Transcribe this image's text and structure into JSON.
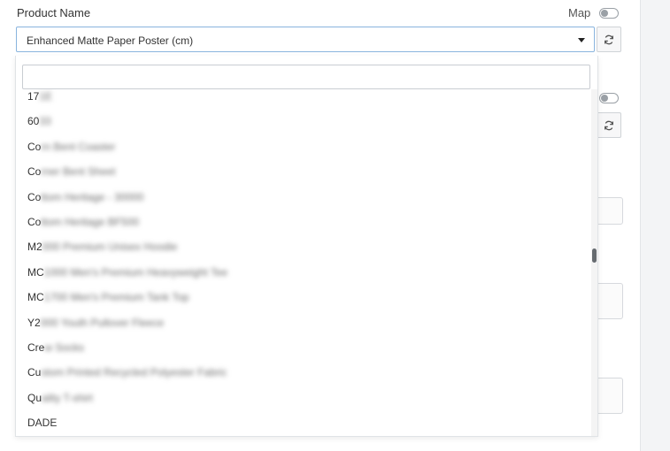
{
  "field": {
    "label": "Product Name",
    "map_label": "Map",
    "selected_value": "Enhanced Matte Paper Poster (cm)"
  },
  "dropdown": {
    "search_placeholder": "",
    "options": [
      {
        "visible": "17",
        "hidden": "1E"
      },
      {
        "visible": "60",
        "hidden": "33"
      },
      {
        "visible": "Co",
        "hidden": "rn Bent Coaster"
      },
      {
        "visible": "Co",
        "hidden": "rner Bent Sheet"
      },
      {
        "visible": "Co",
        "hidden": "ttom Heritage - 30000"
      },
      {
        "visible": "Co",
        "hidden": "ttom Heritage BF500"
      },
      {
        "visible": "M2",
        "hidden": "000 Premium Unisex Hoodie"
      },
      {
        "visible": "MC",
        "hidden": "1000 Men's Premium Heavyweight Tee"
      },
      {
        "visible": "MC",
        "hidden": "1700 Men's Premium Tank Top"
      },
      {
        "visible": "Y2",
        "hidden": "000 Youth Pullover Fleece"
      },
      {
        "visible": "Cre",
        "hidden": "w Socks"
      },
      {
        "visible": "Cu",
        "hidden": "stom Printed Recycled Polyester Fabric"
      },
      {
        "visible": "Qu",
        "hidden": "ality T-shirt"
      },
      {
        "visible": "DADE",
        "hidden": ""
      }
    ]
  },
  "icons": {
    "caret": "caret-down-icon",
    "refresh": "refresh-icon"
  },
  "colors": {
    "select_border": "#89b4de",
    "scroll_thumb": "#666b70"
  }
}
